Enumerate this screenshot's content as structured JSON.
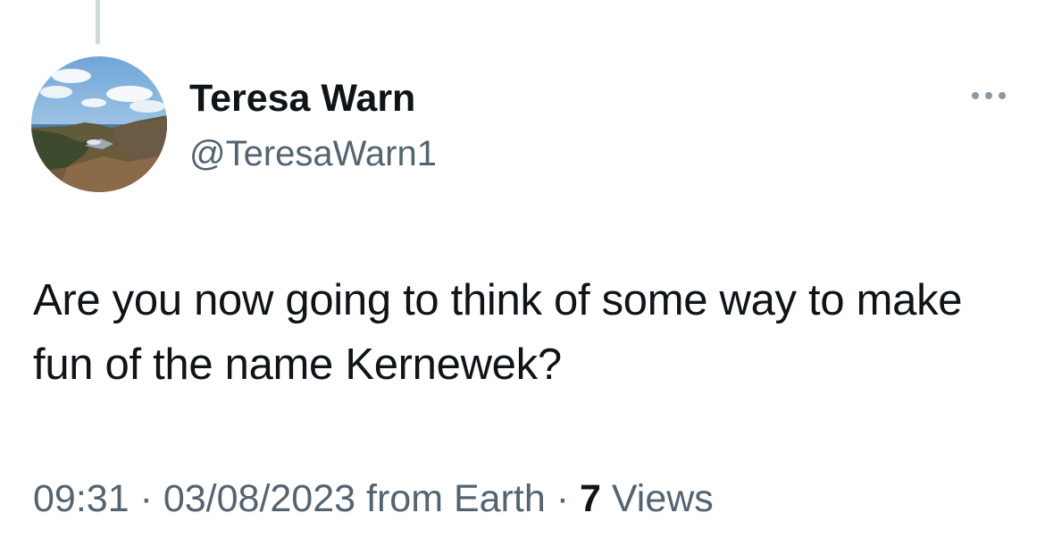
{
  "tweet": {
    "author": {
      "display_name": "Teresa Warn",
      "handle": "@TeresaWarn1",
      "avatar": "coastal-landscape-avatar"
    },
    "text": "Are you now going to think of some way to make fun of the name Kernewek?",
    "time": "09:31",
    "separator": "·",
    "date": "03/08/2023",
    "source": "from Earth",
    "views_count": "7",
    "views_label": "Views",
    "more_icon": "more-horizontal-icon"
  },
  "colors": {
    "primary_text": "#0f1419",
    "secondary_text": "#536471",
    "thread_line": "#cfd9de"
  }
}
